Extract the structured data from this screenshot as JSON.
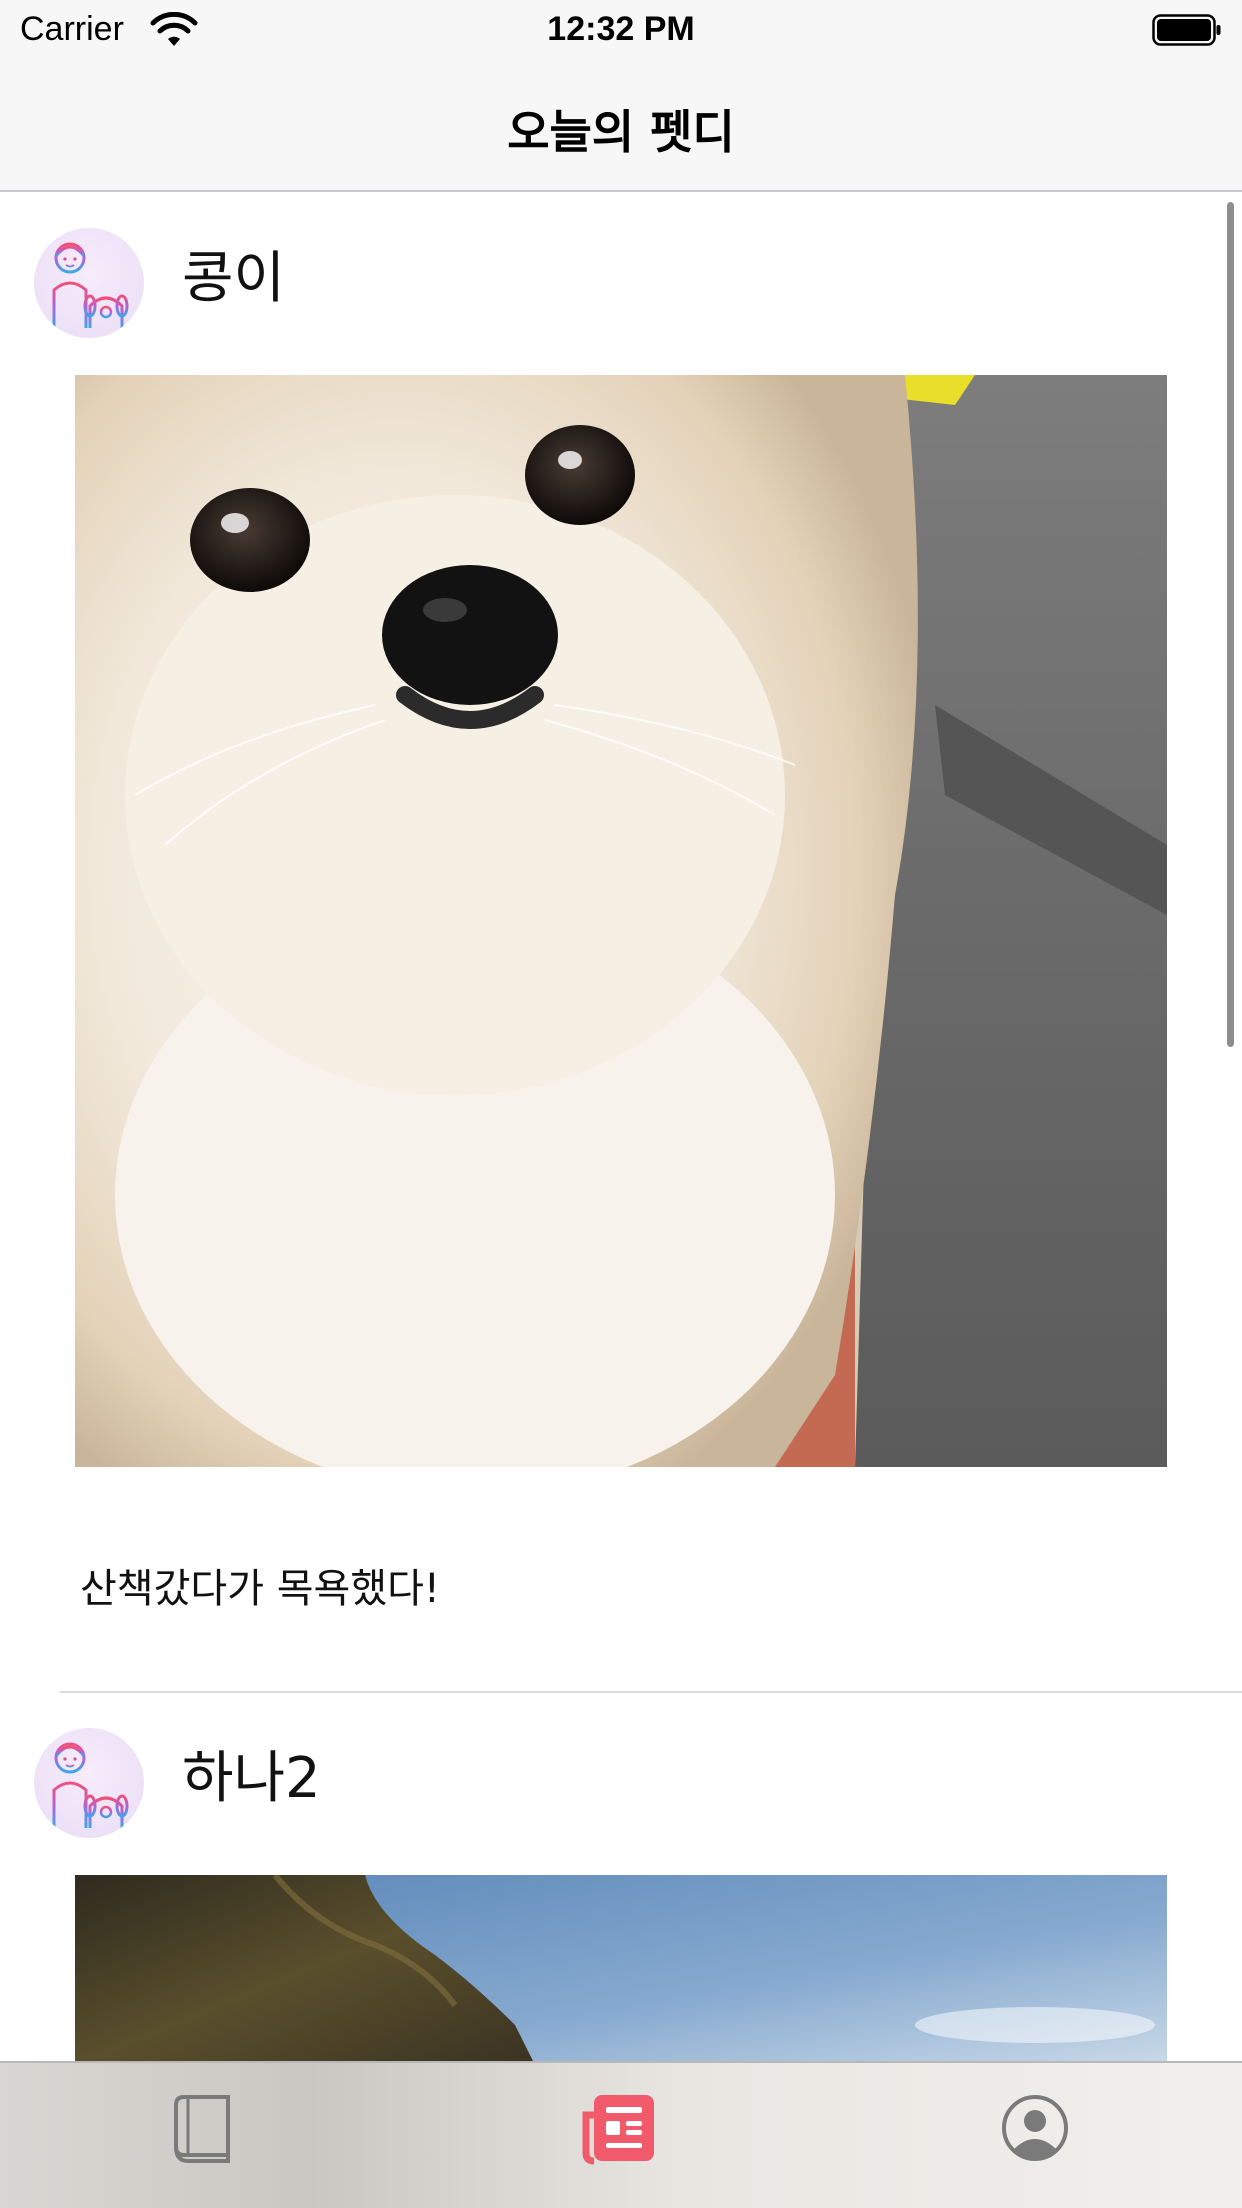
{
  "status_bar": {
    "carrier": "Carrier",
    "time": "12:32 PM"
  },
  "nav": {
    "title": "오늘의 펫디"
  },
  "feed": {
    "posts": [
      {
        "pet_name": "콩이",
        "caption": "산책갔다가 목욕했다!"
      },
      {
        "pet_name": "하나2",
        "caption": ""
      }
    ]
  },
  "tab_bar": {
    "tabs": [
      {
        "icon": "book-icon",
        "selected": false
      },
      {
        "icon": "newspaper-icon",
        "selected": true
      },
      {
        "icon": "profile-icon",
        "selected": false
      }
    ],
    "accent_color": "#f15a6a",
    "inactive_color": "#7a7a7a"
  }
}
